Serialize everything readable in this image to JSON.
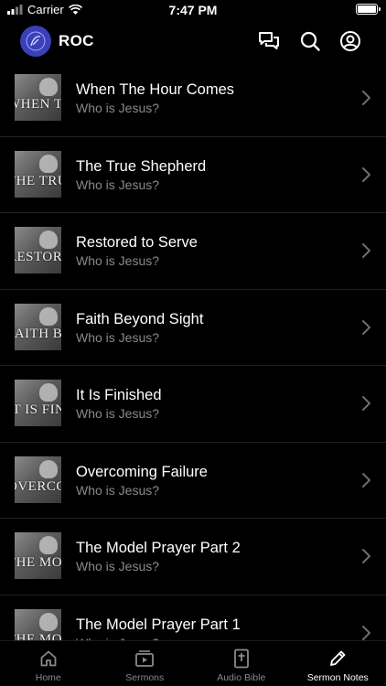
{
  "status_bar": {
    "carrier": "Carrier",
    "time": "7:47 PM"
  },
  "header": {
    "title": "ROC"
  },
  "sermons": [
    {
      "title": "When The Hour Comes",
      "series": "Who is Jesus?",
      "thumb_text": "WHEN THE HOUR COMES"
    },
    {
      "title": "The True Shepherd",
      "series": "Who is Jesus?",
      "thumb_text": "THE TRUE SHEPHERD"
    },
    {
      "title": "Restored to Serve",
      "series": "Who is Jesus?",
      "thumb_text": "RESTORED TO SERVE"
    },
    {
      "title": "Faith Beyond Sight",
      "series": "Who is Jesus?",
      "thumb_text": "FAITH BEYOND SIGHT"
    },
    {
      "title": "It Is Finished",
      "series": "Who is Jesus?",
      "thumb_text": "IT IS FINISHED"
    },
    {
      "title": "Overcoming Failure",
      "series": "Who is Jesus?",
      "thumb_text": "OVERCOMING FAILURE"
    },
    {
      "title": "The Model Prayer Part 2",
      "series": "Who is Jesus?",
      "thumb_text": "THE MODEL PRAYER"
    },
    {
      "title": "The Model Prayer Part 1",
      "series": "Who is Jesus?",
      "thumb_text": "THE MODEL PRAYER"
    }
  ],
  "tabs": [
    {
      "label": "Home",
      "icon": "home-icon",
      "active": false
    },
    {
      "label": "Sermons",
      "icon": "video-icon",
      "active": false
    },
    {
      "label": "Audio Bible",
      "icon": "bible-icon",
      "active": false
    },
    {
      "label": "Sermon Notes",
      "icon": "pencil-icon",
      "active": true
    }
  ]
}
